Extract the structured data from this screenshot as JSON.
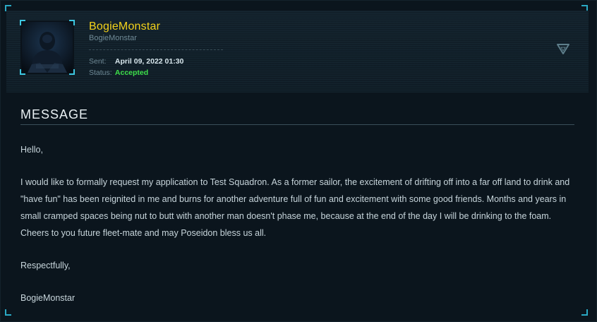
{
  "user": {
    "display_name": "BogieMonstar",
    "handle": "BogieMonstar"
  },
  "meta": {
    "sent_label": "Sent:",
    "sent_value": "April 09, 2022 01:30",
    "status_label": "Status:",
    "status_value": "Accepted"
  },
  "message": {
    "heading": "MESSAGE",
    "paragraphs": [
      "Hello,",
      "I would like to formally request my application to Test Squadron. As a former sailor, the excitement of drifting off into a far off land to drink and \"have fun\" has been reignited in me and burns for another adventure full of fun and excitement with some good friends. Months and years in small cramped spaces being nut to butt with another man doesn't phase me, because at the end of the day I will be drinking to the foam. Cheers to you future fleet-mate and may Poseidon bless us all.",
      "Respectfully,",
      "BogieMonstar"
    ]
  },
  "colors": {
    "username": "#f3d21b",
    "accepted": "#3ee04a",
    "accent": "#2aa9c4",
    "background": "#0b151d"
  },
  "icons": {
    "toggle": "triangle-down-icon",
    "avatar": "avatar-image"
  }
}
